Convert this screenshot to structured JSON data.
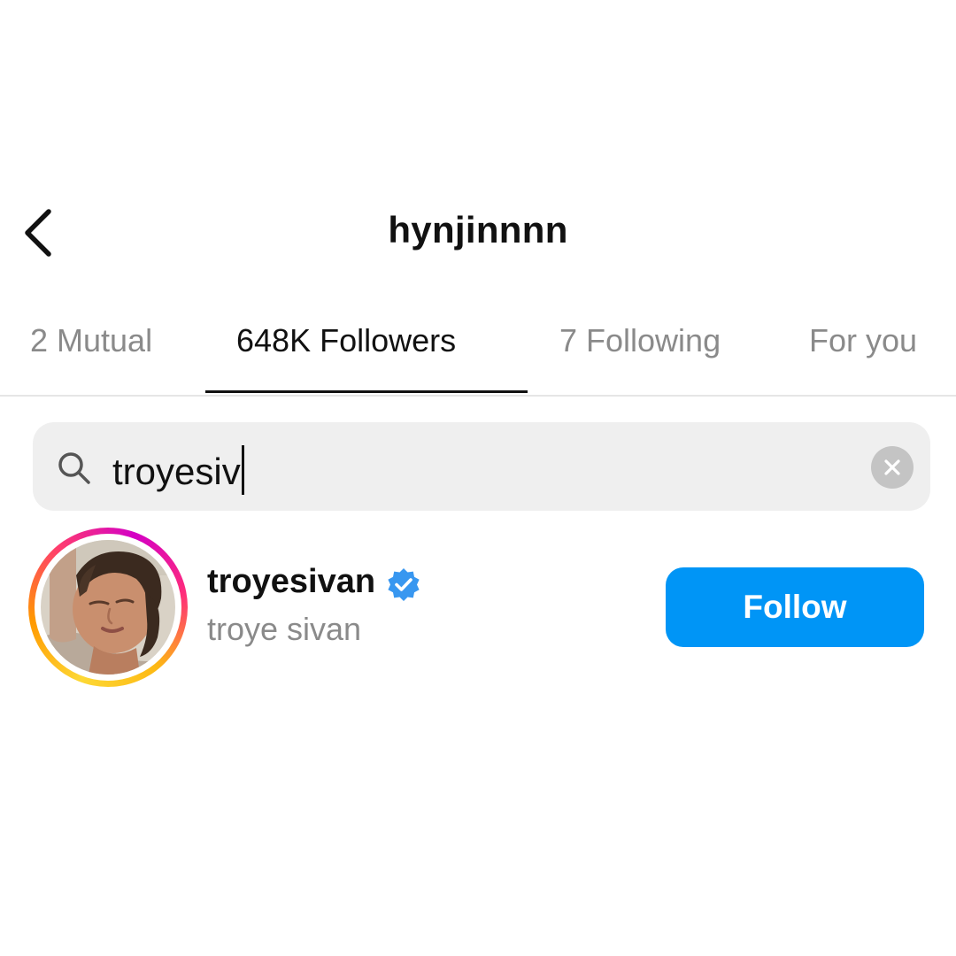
{
  "header": {
    "title": "hynjinnnn",
    "back_icon": "chevron-left-icon"
  },
  "tabs": [
    {
      "label": "2 Mutual",
      "active": false
    },
    {
      "label": "648K Followers",
      "active": true
    },
    {
      "label": "7 Following",
      "active": false
    },
    {
      "label": "For you",
      "active": false
    }
  ],
  "search": {
    "value": "troyesiv",
    "icon": "search-icon",
    "clear_icon": "clear-icon"
  },
  "results": [
    {
      "username": "troyesivan",
      "full_name": "troye sivan",
      "verified": true,
      "follow_label": "Follow"
    }
  ],
  "colors": {
    "follow_button": "#0095f6",
    "verified_badge": "#3897f0",
    "search_background": "#efefef",
    "inactive_text": "#8a8a8a"
  }
}
